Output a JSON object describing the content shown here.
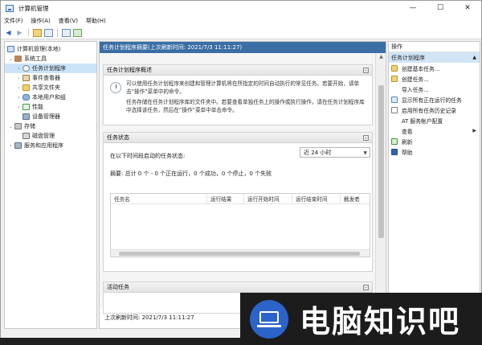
{
  "window": {
    "title": "计算机管理",
    "controls": {
      "minimize": "—",
      "maximize": "☐",
      "close": "✕"
    }
  },
  "menu": [
    "文件(F)",
    "操作(A)",
    "查看(V)",
    "帮助(H)"
  ],
  "toolbar": {
    "back_icon": "arrow-left-icon",
    "forward_icon": "arrow-right-icon"
  },
  "tree": {
    "items": [
      {
        "label": "计算机管理(本地)",
        "level": 0,
        "expand": "",
        "icon": "computer-icon"
      },
      {
        "label": "系统工具",
        "level": 1,
        "expand": "⌄",
        "icon": "tools-icon"
      },
      {
        "label": "任务计划程序",
        "level": 2,
        "expand": "›",
        "icon": "clock-icon",
        "selected": true
      },
      {
        "label": "事件查看器",
        "level": 2,
        "expand": "›",
        "icon": "event-viewer-icon"
      },
      {
        "label": "共享文件夹",
        "level": 2,
        "expand": "›",
        "icon": "shared-folder-icon"
      },
      {
        "label": "本地用户和组",
        "level": 2,
        "expand": "›",
        "icon": "users-icon"
      },
      {
        "label": "性能",
        "level": 2,
        "expand": "›",
        "icon": "performance-icon"
      },
      {
        "label": "设备管理器",
        "level": 2,
        "expand": "",
        "icon": "device-manager-icon"
      },
      {
        "label": "存储",
        "level": 1,
        "expand": "⌄",
        "icon": "storage-icon"
      },
      {
        "label": "磁盘管理",
        "level": 2,
        "expand": "",
        "icon": "disk-icon"
      },
      {
        "label": "服务和应用程序",
        "level": 1,
        "expand": "›",
        "icon": "services-icon"
      }
    ]
  },
  "center": {
    "header": "任务计划程序摘要(上次刷新时间: 2021/7/3 11:11:27)",
    "overview": {
      "title": "任务计划程序概述",
      "p1": "可以使用任务计划程序来创建和管理计算机将在所指定的时间自动执行的常见任务。若要开始，请单击“操作”菜单中的命令。",
      "p2": "任务存储在任务计划程序库的文件夹中。若要查看单独任务上的操作或执行操作，请在任务计划程序库中选择该任务，然后在“操作”菜单中单击命令。"
    },
    "status": {
      "title": "任务状态",
      "period_label": "在以下时间段启动的任务状态:",
      "period_value": "近 24 小时",
      "summary": "摘要: 总计 0 个 - 0 个正在运行，0 个成功，0 个停止，0 个失败",
      "columns": [
        "任务名",
        "运行结果",
        "运行开始时间",
        "运行结束时间",
        "触发者"
      ]
    },
    "active": {
      "title": "活动任务"
    },
    "last_refresh": "上次刷新时间: 2021/7/3 11:11:27"
  },
  "actions": {
    "header": "操作",
    "group": "任务计划程序",
    "items": [
      {
        "label": "创建基本任务...",
        "icon": "create-basic-task-icon",
        "cls": "a-task"
      },
      {
        "label": "创建任务...",
        "icon": "create-task-icon",
        "cls": "a-task"
      },
      {
        "label": "导入任务...",
        "icon": "import-task-icon",
        "cls": "a-none"
      },
      {
        "label": "显示所有正在运行的任务",
        "icon": "running-tasks-icon",
        "cls": "a-show"
      },
      {
        "label": "启用所有任务历史记录",
        "icon": "history-icon",
        "cls": "a-hist"
      },
      {
        "label": "AT 服务帐户配置",
        "icon": "at-config-icon",
        "cls": "a-none"
      },
      {
        "label": "查看",
        "icon": "view-icon",
        "cls": "a-none",
        "submenu": true
      },
      {
        "label": "刷新",
        "icon": "refresh-icon",
        "cls": "a-refresh"
      },
      {
        "label": "帮助",
        "icon": "help-icon",
        "cls": "a-help"
      }
    ]
  },
  "watermark": {
    "text": "电脑知识吧"
  }
}
